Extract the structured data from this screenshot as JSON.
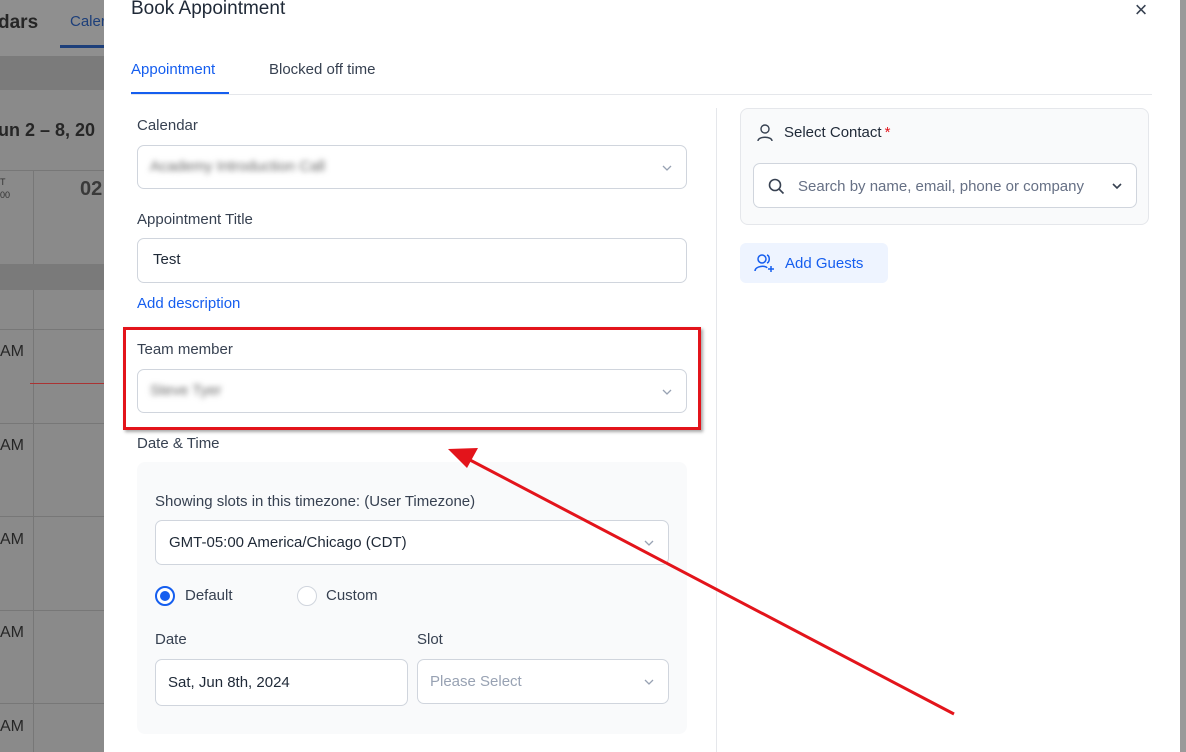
{
  "background": {
    "brand_partial": "dars",
    "tab_partial": "Caler",
    "range_partial": "un 2 – 8, 20",
    "tz_partial": "T\n00",
    "day_partial": "02",
    "hour_labels": [
      "AM",
      "AM",
      "AM",
      "AM",
      "AM"
    ]
  },
  "modal": {
    "title": "Book Appointment",
    "close_icon": "×"
  },
  "tabs": [
    {
      "label": "Appointment",
      "active": true
    },
    {
      "label": "Blocked off time",
      "active": false
    }
  ],
  "form": {
    "calendar_label": "Calendar",
    "calendar_value_blurred": "Academy Introduction Call",
    "title_label": "Appointment Title",
    "title_value": "Test",
    "add_description": "Add description",
    "team_member_label": "Team member",
    "team_member_value_blurred": "Steve Tyer",
    "datetime_label": "Date & Time",
    "timezone_caption": "Showing slots in this timezone: (User Timezone)",
    "timezone_value": "GMT-05:00 America/Chicago (CDT)",
    "radio_default": "Default",
    "radio_custom": "Custom",
    "date_label": "Date",
    "date_value": "Sat, Jun 8th, 2024",
    "slot_label": "Slot",
    "slot_placeholder": "Please Select"
  },
  "contact": {
    "label": "Select Contact",
    "required_mark": "*",
    "search_placeholder": "Search by name, email, phone or company"
  },
  "guests": {
    "label": "Add Guests"
  },
  "colors": {
    "accent": "#155eef",
    "annotation": "#e3141b"
  }
}
